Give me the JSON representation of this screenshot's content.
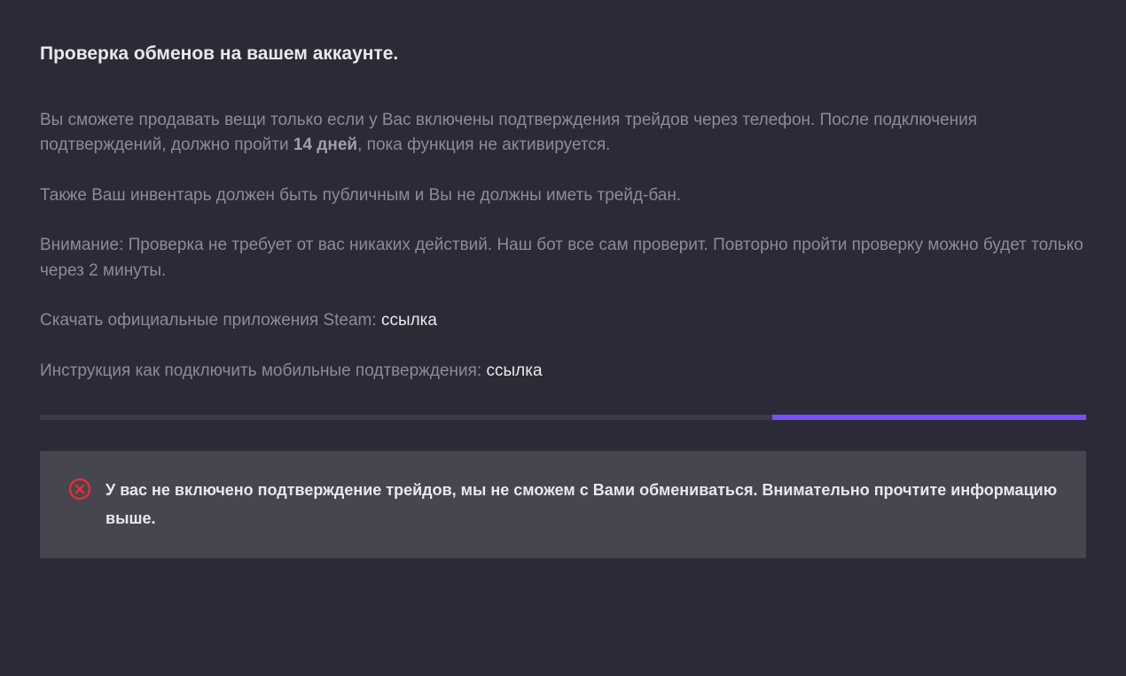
{
  "heading": "Проверка обменов на вашем аккаунте.",
  "para1_a": "Вы сможете продавать вещи только если у Вас включены подтверждения трейдов через телефон. После подключения подтверждений, должно пройти ",
  "para1_bold": "14 дней",
  "para1_b": ", пока функция не активируется.",
  "para2": "Также Ваш инвентарь должен быть публичным и Вы не должны иметь трейд-бан.",
  "para3": "Внимание: Проверка не требует от вас никаких действий. Наш бот все сам проверит. Повторно пройти проверку можно будет только через 2 минуты.",
  "para4_label": "Скачать официальные приложения Steam: ",
  "para4_link": "ссылка",
  "para5_label": "Инструкция как подключить мобильные подтверждения: ",
  "para5_link": "ссылка",
  "alert_text": "У вас не включено подтверждение трейдов, мы не сможем с Вами обмениваться. Внимательно прочтите информацию выше.",
  "progress_fill_percent": 30,
  "colors": {
    "accent": "#7c4dff",
    "error": "#e03030"
  }
}
